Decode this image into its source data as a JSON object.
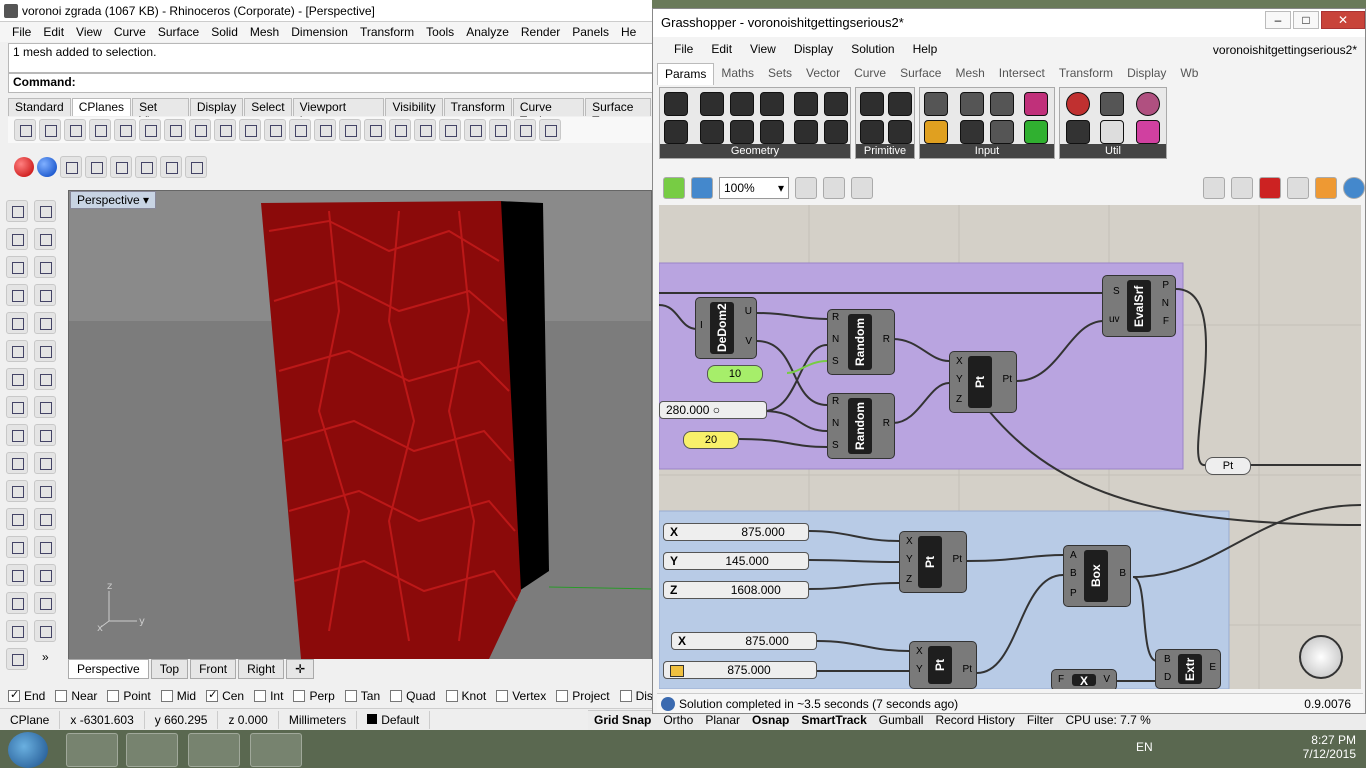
{
  "rhino": {
    "title": "voronoi zgrada (1067 KB) - Rhinoceros (Corporate) - [Perspective]",
    "menu": [
      "File",
      "Edit",
      "View",
      "Curve",
      "Surface",
      "Solid",
      "Mesh",
      "Dimension",
      "Transform",
      "Tools",
      "Analyze",
      "Render",
      "Panels",
      "He"
    ],
    "history": "1 mesh added to selection.",
    "command_label": "Command:",
    "toolbar_tabs": [
      "Standard",
      "CPlanes",
      "Set View",
      "Display",
      "Select",
      "Viewport Layout",
      "Visibility",
      "Transform",
      "Curve Tools",
      "Surface To"
    ],
    "active_tab": "CPlanes",
    "viewport_label": "Perspective",
    "viewport_tabs": [
      "Perspective",
      "Top",
      "Front",
      "Right"
    ],
    "snaps": [
      {
        "label": "End",
        "on": true
      },
      {
        "label": "Near",
        "on": false
      },
      {
        "label": "Point",
        "on": false
      },
      {
        "label": "Mid",
        "on": false
      },
      {
        "label": "Cen",
        "on": true
      },
      {
        "label": "Int",
        "on": false
      },
      {
        "label": "Perp",
        "on": false
      },
      {
        "label": "Tan",
        "on": false
      },
      {
        "label": "Quad",
        "on": false
      },
      {
        "label": "Knot",
        "on": false
      },
      {
        "label": "Vertex",
        "on": false
      },
      {
        "label": "Project",
        "on": false
      },
      {
        "label": "Disable",
        "on": false
      }
    ],
    "status": {
      "cplane": "CPlane",
      "x": "x -6301.603",
      "y": "y 660.295",
      "z": "z 0.000",
      "units": "Millimeters",
      "layer": "Default",
      "grid_snap": "Grid Snap",
      "ortho": "Ortho",
      "planar": "Planar",
      "osnap": "Osnap",
      "smarttrack": "SmartTrack",
      "gumball": "Gumball",
      "record_history": "Record History",
      "filter": "Filter",
      "cpu": "CPU use: 7.7 %"
    },
    "axis_labels": {
      "z": "z",
      "y": "y",
      "x": "x"
    },
    "colors": {
      "mesh_red": "#8b0a0a",
      "viewport_bg": "#7b7b7b"
    }
  },
  "gh": {
    "title": "Grasshopper - voronoishitgettingserious2*",
    "filename": "voronoishitgettingserious2*",
    "menu": [
      "File",
      "Edit",
      "View",
      "Display",
      "Solution",
      "Help"
    ],
    "tabs": [
      "Params",
      "Maths",
      "Sets",
      "Vector",
      "Curve",
      "Surface",
      "Mesh",
      "Intersect",
      "Transform",
      "Display",
      "Wb"
    ],
    "active_tab": "Params",
    "panels": [
      "Geometry",
      "Primitive",
      "Input",
      "Util"
    ],
    "zoom": "100%",
    "status": "Solution completed in ~3.5 seconds (7 seconds ago)",
    "version": "0.9.0076",
    "components": {
      "dedom": {
        "name": "DeDom2",
        "inputs": [
          "I"
        ],
        "outputs": [
          "U",
          "V"
        ]
      },
      "random1": {
        "name": "Random",
        "inputs": [
          "R",
          "N",
          "S"
        ],
        "outputs": [
          "R"
        ]
      },
      "random2": {
        "name": "Random",
        "inputs": [
          "R",
          "N",
          "S"
        ],
        "outputs": [
          "R"
        ]
      },
      "pt1": {
        "name": "Pt",
        "inputs": [
          "X",
          "Y",
          "Z"
        ],
        "outputs": [
          "Pt"
        ]
      },
      "evalsrf": {
        "name": "EvalSrf",
        "inputs": [
          "S",
          "uv"
        ],
        "outputs": [
          "P",
          "N",
          "F"
        ]
      },
      "pt_param": {
        "name": "Pt"
      },
      "pt2": {
        "name": "Pt",
        "inputs": [
          "X",
          "Y",
          "Z"
        ],
        "outputs": [
          "Pt"
        ]
      },
      "box": {
        "name": "Box",
        "inputs": [
          "A",
          "B",
          "P"
        ],
        "outputs": [
          "B"
        ]
      },
      "pt3": {
        "name": "Pt",
        "inputs": [
          "X",
          "Y"
        ],
        "outputs": [
          "Pt"
        ]
      },
      "extr": {
        "name": "Extr",
        "inputs": [
          "B",
          "D"
        ],
        "outputs": [
          "E"
        ]
      },
      "xcomp": {
        "name": "X",
        "inputs": [
          "F"
        ],
        "outputs": [
          "V"
        ]
      }
    },
    "numbers": {
      "n10": "10",
      "n20": "20"
    },
    "sliders": {
      "s280": "280.000",
      "sx": {
        "key": "X",
        "value": "875.000"
      },
      "sy": {
        "key": "Y",
        "value": "145.000"
      },
      "sz": {
        "key": "Z",
        "value": "1608.000"
      },
      "sx2": {
        "key": "X",
        "value": "875.000"
      },
      "s875b": "875.000"
    },
    "colors": {
      "group_purple": "#b9a4e0",
      "group_blue": "#b8cbe6",
      "canvas": "#d4d0c8"
    }
  },
  "taskbar": {
    "lang": "EN",
    "time": "8:27 PM",
    "date": "7/12/2015"
  }
}
